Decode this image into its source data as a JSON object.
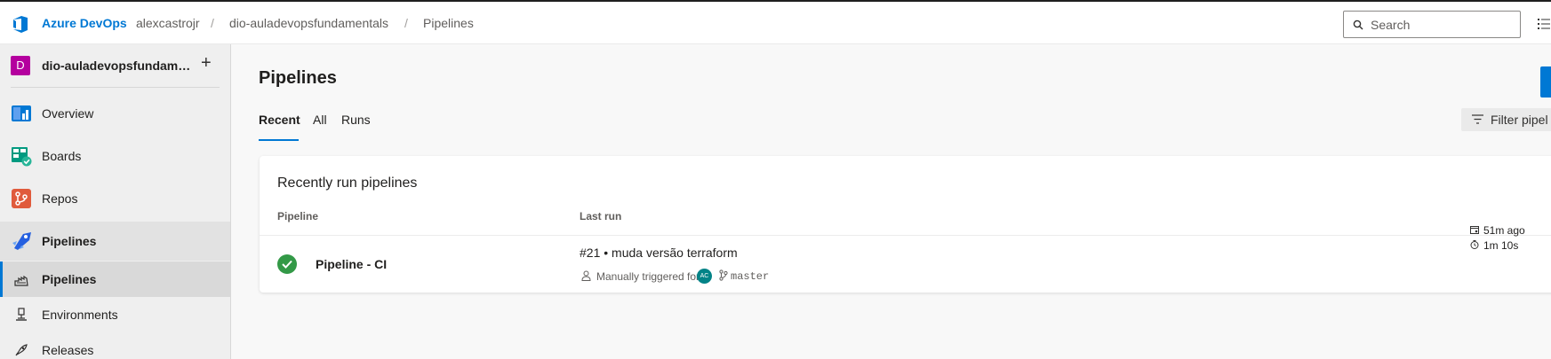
{
  "topbar": {
    "brand": "Azure DevOps",
    "breadcrumbs": [
      "alexcastrojr",
      "dio-auladevopsfundamentals",
      "Pipelines"
    ],
    "separator": "/",
    "search_placeholder": "Search"
  },
  "sidebar": {
    "project": {
      "avatar_letter": "D",
      "name": "dio-auladevopsfundamentals",
      "add_label": "+"
    },
    "items": [
      {
        "label": "Overview",
        "icon": "overview-icon"
      },
      {
        "label": "Boards",
        "icon": "boards-icon"
      },
      {
        "label": "Repos",
        "icon": "repos-icon"
      },
      {
        "label": "Pipelines",
        "icon": "pipelines-icon",
        "active": true
      }
    ],
    "subitems": [
      {
        "label": "Pipelines",
        "icon": "pipeline-rocket-icon",
        "selected": true
      },
      {
        "label": "Environments",
        "icon": "environments-icon"
      },
      {
        "label": "Releases",
        "icon": "releases-icon"
      }
    ]
  },
  "main": {
    "title": "Pipelines",
    "tabs": [
      {
        "label": "Recent",
        "active": true
      },
      {
        "label": "All"
      },
      {
        "label": "Runs"
      }
    ],
    "filter_text": "Filter pipel",
    "card": {
      "title": "Recently run pipelines",
      "columns": [
        "Pipeline",
        "Last run"
      ],
      "rows": [
        {
          "status": "succeeded",
          "name": "Pipeline - CI",
          "run_title": "#21 • muda versão terraform",
          "trigger_text": "Manually triggered for",
          "avatar_initials": "AC",
          "branch": "master",
          "ago": "51m ago",
          "duration": "1m 10s"
        }
      ]
    }
  },
  "colors": {
    "accent": "#0078d4",
    "success": "#339947",
    "project_avatar": "#b4009e"
  }
}
